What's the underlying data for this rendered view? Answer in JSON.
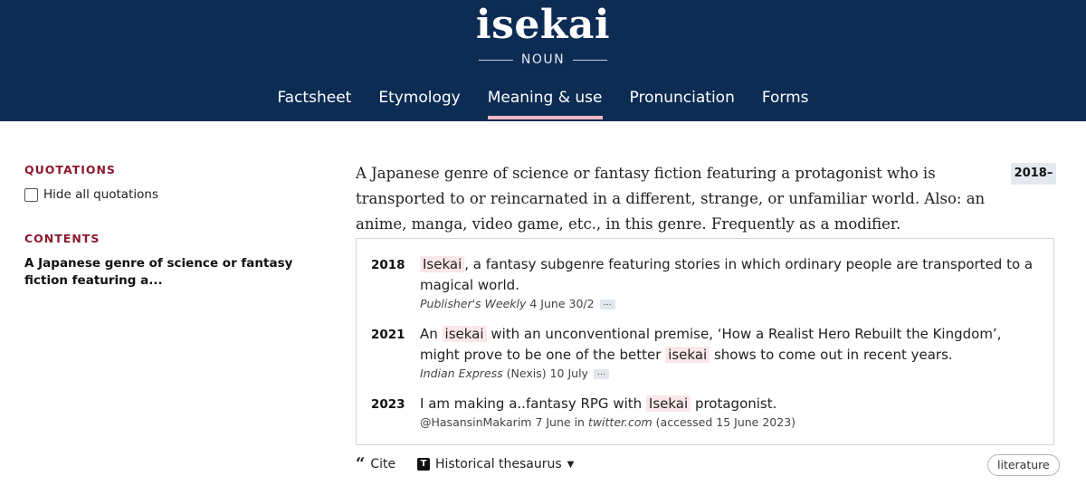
{
  "header": {
    "headword": "isekai",
    "part_of_speech": "NOUN",
    "nav": [
      {
        "label": "Factsheet"
      },
      {
        "label": "Etymology"
      },
      {
        "label": "Meaning & use"
      },
      {
        "label": "Pronunciation"
      },
      {
        "label": "Forms"
      }
    ],
    "active_tab": "Meaning & use"
  },
  "sidebar": {
    "quotations_heading": "QUOTATIONS",
    "hide_quotations_label": "Hide all quotations",
    "contents_heading": "CONTENTS",
    "contents_item": "A Japanese genre of science or fantasy fiction featuring a..."
  },
  "definition": {
    "text": "A Japanese genre of science or fantasy fiction featuring a protagonist who is transported to or reincarnated in a different, strange, or unfamiliar world. Also: an anime, manga, video game, etc., in this genre. Frequently as a modifier.",
    "date_range": "2018–"
  },
  "quotations": [
    {
      "year": "2018",
      "parts": [
        {
          "text": "Isekai",
          "hl": true
        },
        {
          "text": ", a fantasy subgenre featuring stories in which ordinary people are transported to a magical world.",
          "hl": false
        }
      ],
      "source_italic": "Publisher's Weekly",
      "source_rest": " 4 June 30/2",
      "more": "…"
    },
    {
      "year": "2021",
      "parts": [
        {
          "text": "An ",
          "hl": false
        },
        {
          "text": "isekai",
          "hl": true
        },
        {
          "text": " with an unconventional premise, ‘How a Realist Hero Rebuilt the Kingdom’, might prove to be one of the better ",
          "hl": false
        },
        {
          "text": "isekai",
          "hl": true
        },
        {
          "text": " shows to come out in recent years.",
          "hl": false
        }
      ],
      "source_italic": "Indian Express",
      "source_rest": " (Nexis) 10 July",
      "more": "…"
    },
    {
      "year": "2023",
      "parts": [
        {
          "text": "I am making a..fantasy RPG with ",
          "hl": false
        },
        {
          "text": "Isekai",
          "hl": true
        },
        {
          "text": " protagonist.",
          "hl": false
        }
      ],
      "source_pre": "@HasansinMakarim 7 June in ",
      "source_italic": "twitter.com",
      "source_rest": " (accessed 15 June 2023)"
    }
  ],
  "actions": {
    "cite_icon": "“",
    "cite_label": "Cite",
    "thesaurus_icon": "T",
    "thesaurus_label": "Historical thesaurus",
    "thesaurus_caret": "▼",
    "tag_label": "literature"
  }
}
